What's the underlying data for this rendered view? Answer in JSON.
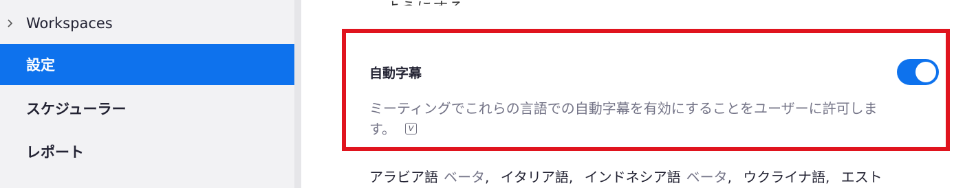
{
  "sidebar": {
    "items": [
      {
        "label": "Workspaces",
        "state": "collapsed",
        "icon": "chevron-right-icon"
      },
      {
        "label": "設定",
        "state": "active"
      },
      {
        "label": "スケジューラー",
        "state": "normal"
      },
      {
        "label": "レポート",
        "state": "normal"
      }
    ]
  },
  "main": {
    "top_fragment": "ようにする",
    "setting": {
      "title": "自動字幕",
      "description": "ミーティングでこれらの言語での自動字幕を有効にすることをユーザーに許可します。",
      "info_icon": "v-tag-icon",
      "enabled": true
    },
    "languages": [
      {
        "name": "アラビア語",
        "badge": "ベータ"
      },
      {
        "name": "イタリア語"
      },
      {
        "name": "インドネシア語",
        "badge": "ベータ"
      },
      {
        "name": "ウクライナ語"
      },
      {
        "name": "エスト"
      }
    ]
  },
  "colors": {
    "accent": "#0e72ed",
    "highlight": "#e0141e",
    "sidebar_bg": "#f2f2f4",
    "muted_text": "#747487"
  }
}
